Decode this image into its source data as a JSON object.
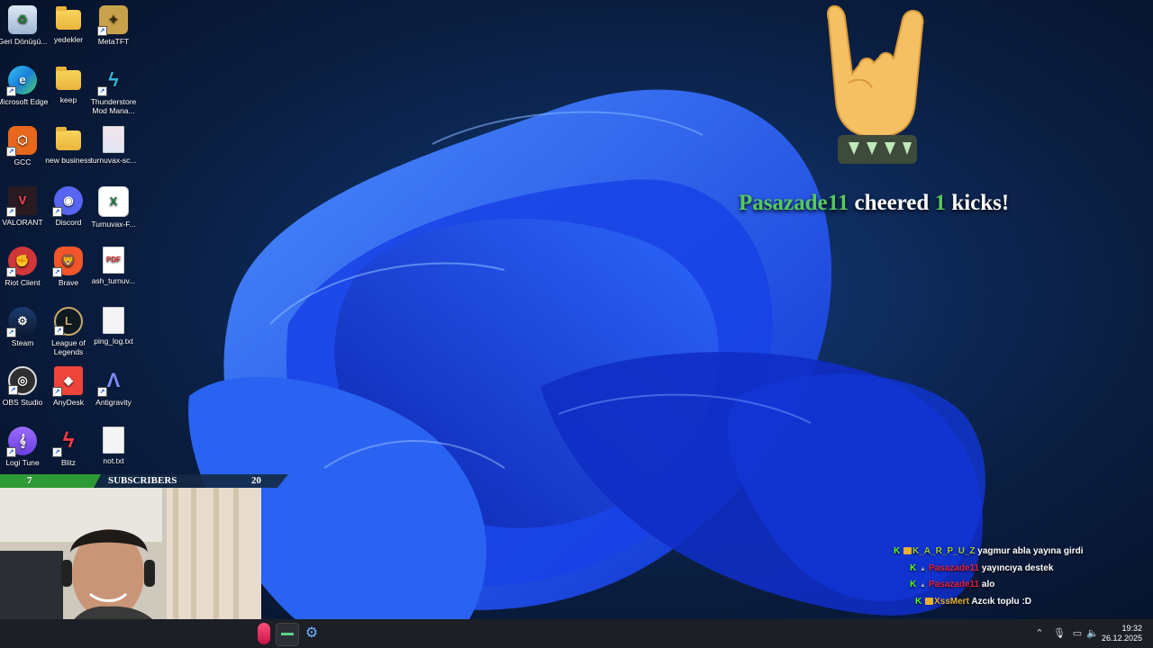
{
  "desktop": {
    "icons": [
      {
        "label": "Geri Dönüşü...",
        "icon": "recycle-bin-icon"
      },
      {
        "label": "yedekler",
        "icon": "folder-icon"
      },
      {
        "label": "MetaTFT",
        "icon": "metatft-icon"
      },
      {
        "label": "Microsoft Edge",
        "icon": "edge-icon"
      },
      {
        "label": "keep",
        "icon": "folder-icon"
      },
      {
        "label": "Thunderstore Mod Mana...",
        "icon": "thunderstore-icon"
      },
      {
        "label": "GCC",
        "icon": "gcc-icon"
      },
      {
        "label": "new business",
        "icon": "folder-icon"
      },
      {
        "label": "turnuvax-sc...",
        "icon": "image-file-icon"
      },
      {
        "label": "VALORANT",
        "icon": "valorant-icon"
      },
      {
        "label": "Discord",
        "icon": "discord-icon"
      },
      {
        "label": "Turnuvax-F...",
        "icon": "excel-icon"
      },
      {
        "label": "Riot Client",
        "icon": "riot-client-icon"
      },
      {
        "label": "Brave",
        "icon": "brave-icon"
      },
      {
        "label": "ash_turnuv...",
        "icon": "pdf-icon"
      },
      {
        "label": "Steam",
        "icon": "steam-icon"
      },
      {
        "label": "League of Legends",
        "icon": "league-icon"
      },
      {
        "label": "ping_log.txt",
        "icon": "text-file-icon"
      },
      {
        "label": "OBS Studio",
        "icon": "obs-icon"
      },
      {
        "label": "AnyDesk",
        "icon": "anydesk-icon"
      },
      {
        "label": "Antigravity",
        "icon": "antigravity-icon"
      },
      {
        "label": "Logi Tune",
        "icon": "logi-tune-icon"
      },
      {
        "label": "Blitz",
        "icon": "blitz-icon"
      },
      {
        "label": "not.txt",
        "icon": "text-file-icon"
      }
    ]
  },
  "alert": {
    "user": "Pasazade11",
    "middle": "cheered",
    "amount": "1",
    "suffix": "kicks!",
    "icon": "rock-hand-emoji-icon"
  },
  "subscribers": {
    "current": "7",
    "label": "SUBSCRIBERS",
    "goal": "20",
    "progress": 0.35
  },
  "chat": {
    "messages": [
      {
        "user": "K_A_R_P_U_Z",
        "text": "yagmur abla yayına girdi",
        "color": "#9ccc34"
      },
      {
        "user": "Pasazade11",
        "text": "yayıncıya destek",
        "color": "#e0223b"
      },
      {
        "user": "Pasazade11",
        "text": "alo",
        "color": "#e0223b"
      },
      {
        "user": "XssMert",
        "text": "Azcık toplu :D",
        "color": "#e8b02e"
      }
    ]
  },
  "taskbar": {
    "time": "19:32",
    "date": "26.12.2025"
  },
  "colors": {
    "accent_green": "#56c95f",
    "kick_green": "#53fc18",
    "wallpaper_blue": "#1f4fe0"
  }
}
